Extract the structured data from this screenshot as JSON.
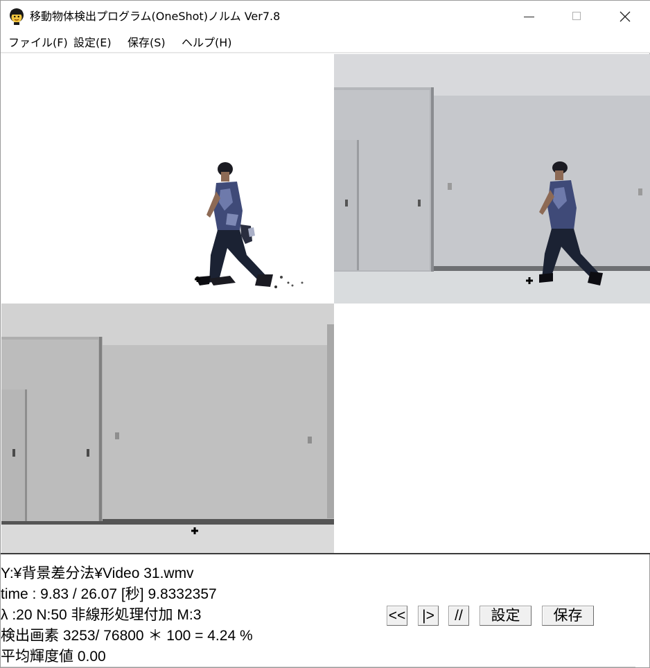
{
  "window": {
    "title": "移動物体検出プログラム(OneShot)ノルム Ver7.8",
    "icon": "face-icon"
  },
  "menu": {
    "file": "ファイル(F)",
    "settings": "設定(E)",
    "save": "保存(S)",
    "help": "ヘルプ(H)"
  },
  "panes": {
    "mask": "detected-foreground-mask",
    "color": "color-video-frame",
    "background": "grayscale-background-frame",
    "empty": "blank-pane"
  },
  "info": {
    "path": "Y:¥背景差分法¥Video 31.wmv",
    "time": "time :   9.83 /  26.07 [秒]   9.8332357",
    "params": "λ :20 N:50 非線形処理付加 M:3",
    "pixels": "検出画素      3253/   76800 ＊ 100 = 4.24 %",
    "luminance": "平均輝度値 0.00"
  },
  "controls": {
    "rewind": "<<",
    "step": "|>",
    "pause": "//",
    "settings": "設定",
    "save": "保存"
  },
  "colors": {
    "window_bg": "#ffffff",
    "wall": "#c9cbcf",
    "floor": "#d9dcde",
    "gray_wall": "#bdbdbd",
    "shirt": "#3f4a78",
    "pants": "#1b2233"
  }
}
